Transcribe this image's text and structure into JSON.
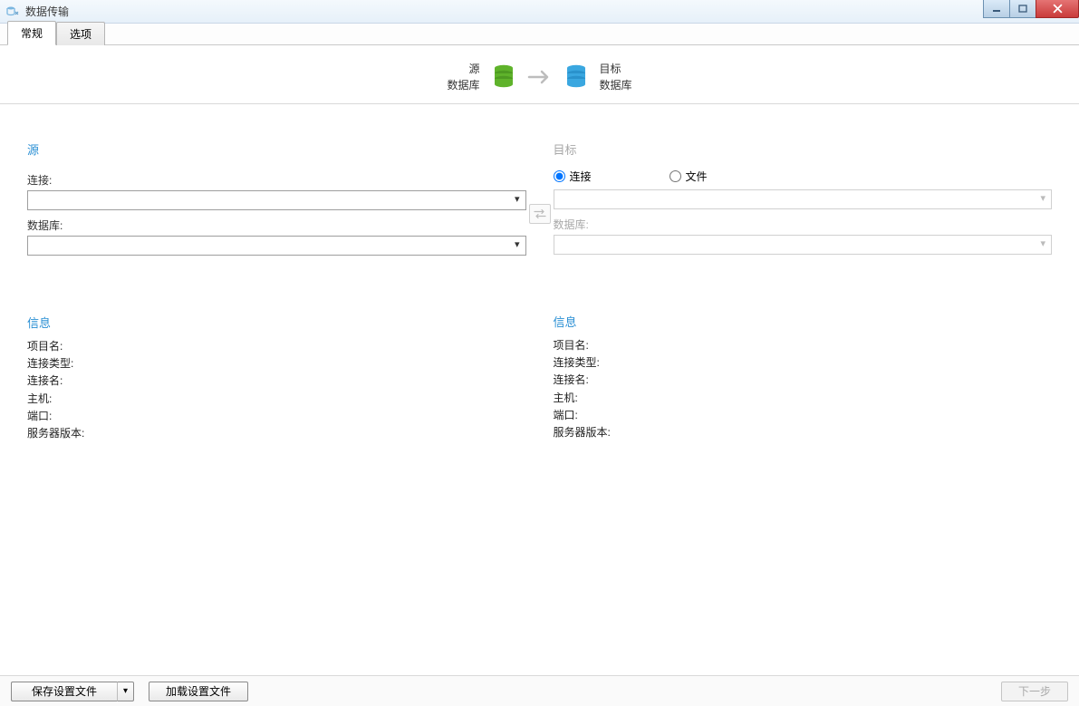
{
  "window": {
    "title": "数据传输"
  },
  "tabs": {
    "general": "常规",
    "options": "选项"
  },
  "diagram": {
    "source_label1": "源",
    "source_label2": "数据库",
    "target_label1": "目标",
    "target_label2": "数据库"
  },
  "source": {
    "title": "源",
    "connection_label": "连接:",
    "database_label": "数据库:"
  },
  "target": {
    "title": "目标",
    "radio_connection": "连接",
    "radio_file": "文件",
    "database_label": "数据库:"
  },
  "info_source": {
    "title": "信息",
    "project": "项目名:",
    "conn_type": "连接类型:",
    "conn_name": "连接名:",
    "host": "主机:",
    "port": "端口:",
    "server_version": "服务器版本:"
  },
  "info_target": {
    "title": "信息",
    "project": "项目名:",
    "conn_type": "连接类型:",
    "conn_name": "连接名:",
    "host": "主机:",
    "port": "端口:",
    "server_version": "服务器版本:"
  },
  "footer": {
    "save_profile": "保存设置文件",
    "load_profile": "加载设置文件",
    "next": "下一步"
  }
}
